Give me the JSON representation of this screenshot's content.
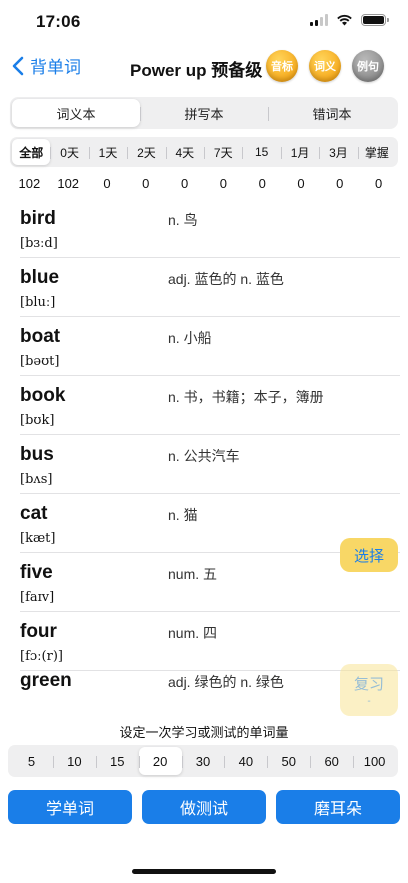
{
  "status": {
    "time": "17:06"
  },
  "nav": {
    "back_label": "背单词",
    "title": "Power up 预备级",
    "badges": [
      "音标",
      "词义",
      "例句"
    ]
  },
  "tabs": [
    "词义本",
    "拼写本",
    "错词本"
  ],
  "filters": [
    "全部",
    "0天",
    "1天",
    "2天",
    "4天",
    "7天",
    "15",
    "1月",
    "3月",
    "掌握"
  ],
  "counts": [
    "102",
    "102",
    "0",
    "0",
    "0",
    "0",
    "0",
    "0",
    "0",
    "0"
  ],
  "words": [
    {
      "word": "bird",
      "phonetic": "[bɜːd]",
      "meaning": "n. 鸟"
    },
    {
      "word": "blue",
      "phonetic": "[bluː]",
      "meaning": "adj. 蓝色的  n. 蓝色"
    },
    {
      "word": "boat",
      "phonetic": "[bəʊt]",
      "meaning": "n. 小船"
    },
    {
      "word": "book",
      "phonetic": "[bʊk]",
      "meaning": "n. 书，书籍；本子，簿册"
    },
    {
      "word": "bus",
      "phonetic": "[bʌs]",
      "meaning": "n. 公共汽车"
    },
    {
      "word": "cat",
      "phonetic": "[kæt]",
      "meaning": "n. 猫"
    },
    {
      "word": "five",
      "phonetic": "[faɪv]",
      "meaning": "num. 五"
    },
    {
      "word": "four",
      "phonetic": "[fɔː(r)]",
      "meaning": "num. 四"
    },
    {
      "word": "green",
      "phonetic": "",
      "meaning": "adj. 绿色的  n. 绿色"
    }
  ],
  "floating": {
    "select_label": "选择",
    "review_label": "复习",
    "review_sub": "-"
  },
  "amount": {
    "hint": "设定一次学习或测试的单词量",
    "options": [
      "5",
      "10",
      "15",
      "20",
      "30",
      "40",
      "50",
      "60",
      "100"
    ],
    "selected": "20"
  },
  "actions": [
    "学单词",
    "做测试",
    "磨耳朵"
  ],
  "colors": {
    "accent": "#1a7ee8",
    "badge_orange": "#f39a05",
    "select_yellow": "#f8d766"
  }
}
